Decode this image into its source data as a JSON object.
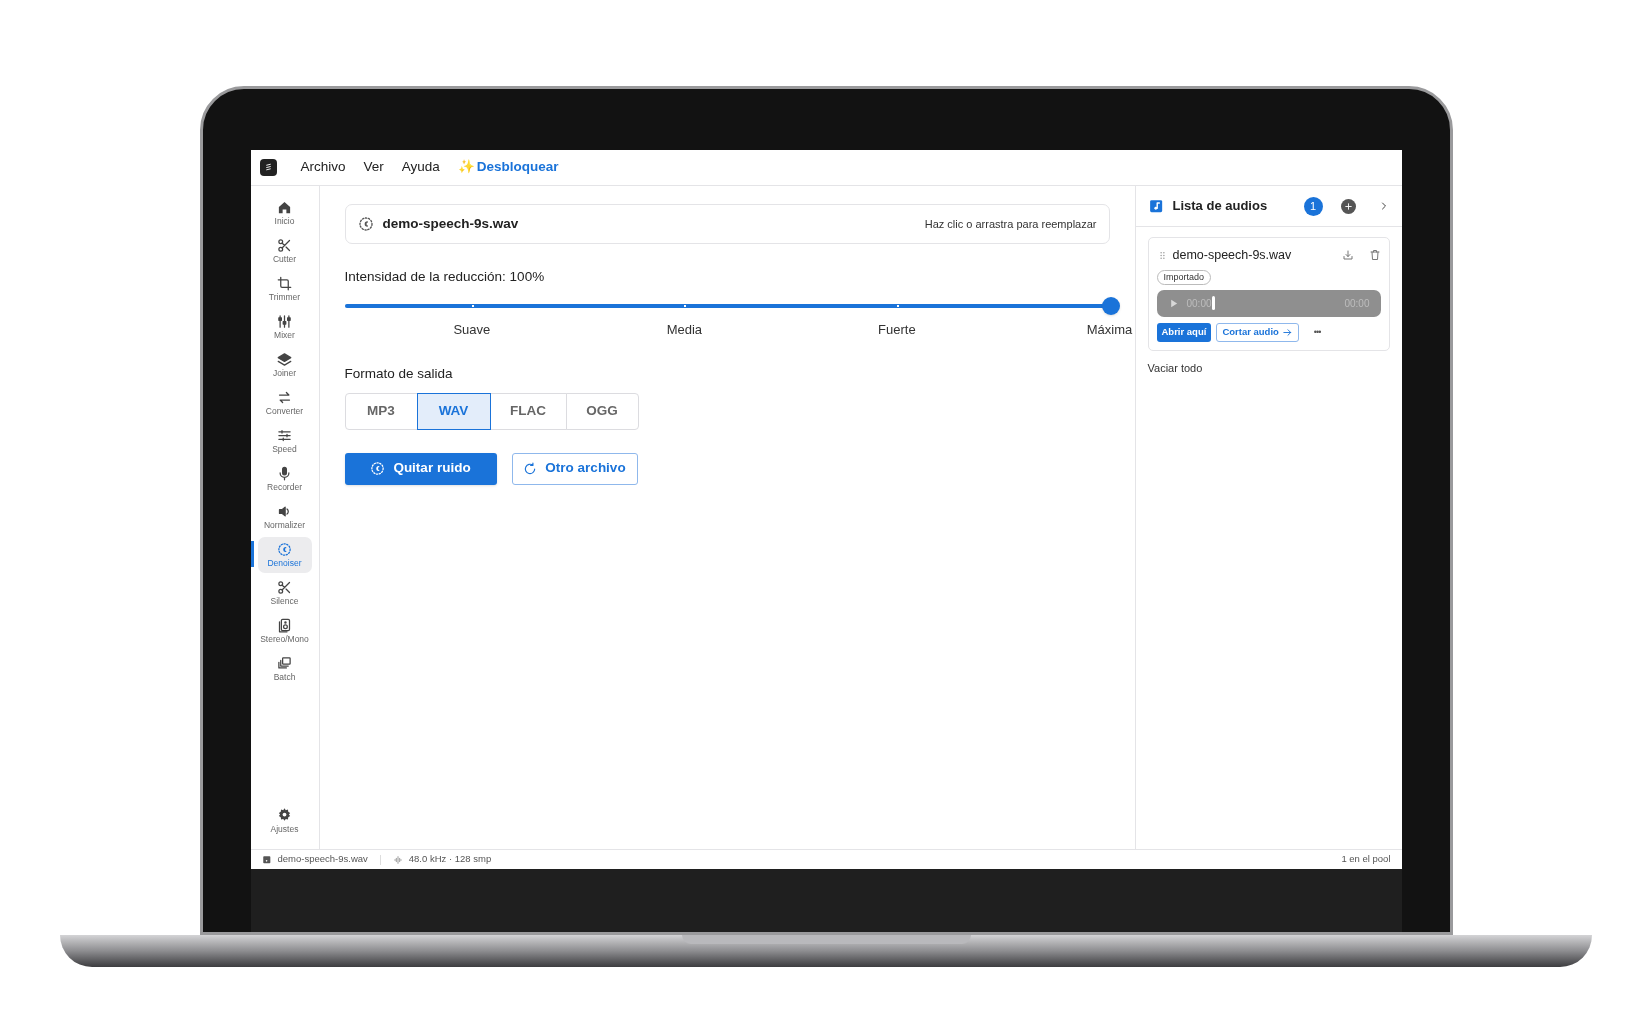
{
  "menu": {
    "items": [
      "Archivo",
      "Ver",
      "Ayuda"
    ],
    "promo": {
      "icon": "✨",
      "label": "Desbloquear"
    }
  },
  "sidebar": {
    "items": [
      {
        "label": "Inicio",
        "selected": false
      },
      {
        "label": "Cutter",
        "selected": false
      },
      {
        "label": "Trimmer",
        "selected": false
      },
      {
        "label": "Mixer",
        "selected": false
      },
      {
        "label": "Joiner",
        "selected": false
      },
      {
        "label": "Converter",
        "selected": false
      },
      {
        "label": "Speed",
        "selected": false
      },
      {
        "label": "Recorder",
        "selected": false
      },
      {
        "label": "Normalizer",
        "selected": false
      },
      {
        "label": "Denoiser",
        "selected": true
      },
      {
        "label": "Silence",
        "selected": false
      },
      {
        "label": "Stereo/Mono",
        "selected": false
      },
      {
        "label": "Batch",
        "selected": false
      }
    ],
    "settings": {
      "label": "Ajustes"
    }
  },
  "file_box": {
    "name": "demo-speech-9s.wav",
    "hint": "Haz clic o arrastra para reemplazar"
  },
  "strength": {
    "label": "Intensidad de la reducción: 100%",
    "level": 1,
    "marks": [
      "Suave",
      "Media",
      "Fuerte",
      "Máxima"
    ]
  },
  "format": {
    "label": "Formato de salida",
    "options": [
      {
        "label": "MP3",
        "selected": false
      },
      {
        "label": "WAV",
        "selected": true
      },
      {
        "label": "FLAC",
        "selected": false
      },
      {
        "label": "OGG",
        "selected": false
      }
    ]
  },
  "actions": {
    "primary": "Quitar ruido",
    "secondary": "Otro archivo"
  },
  "audio_list": {
    "title": "Lista de audios",
    "count": "1",
    "items": [
      {
        "name": "demo-speech-9s.wav",
        "tag": "Importado",
        "time_current": "00:00",
        "time_total": "00:00",
        "open": "Abrir aquí",
        "cut": "Cortar audio",
        "more": "•••"
      }
    ],
    "clear": "Vaciar todo"
  },
  "status_bar": {
    "file": "demo-speech-9s.wav",
    "format": "48.0 kHz · 128 smp",
    "pool": "1 en el pool"
  }
}
